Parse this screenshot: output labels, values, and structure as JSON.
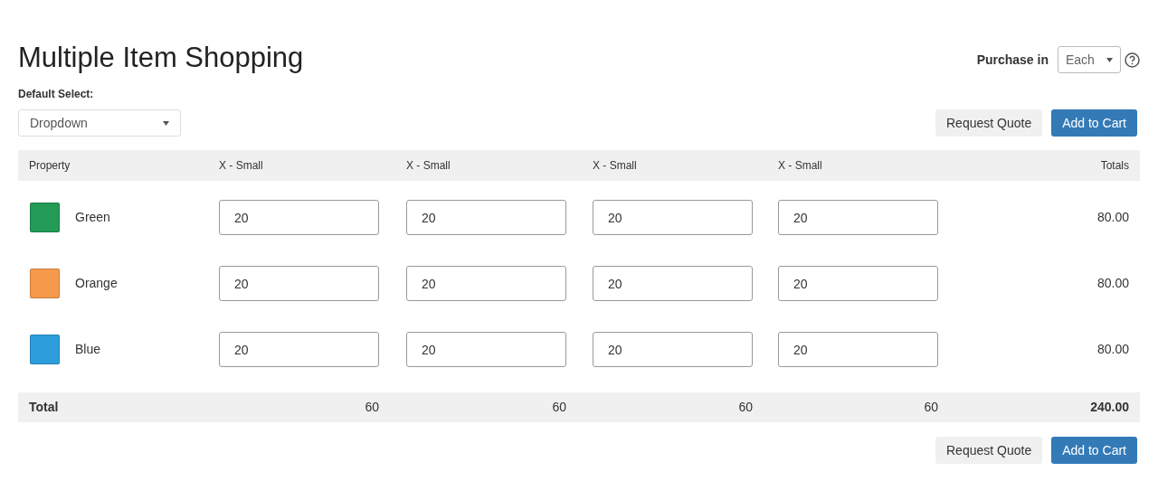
{
  "title": "Multiple Item Shopping",
  "purchase_in": {
    "label": "Purchase in",
    "value": "Each"
  },
  "default_select": {
    "label": "Default Select:",
    "value": "Dropdown"
  },
  "actions_top": [
    {
      "label": "Request Quote",
      "kind": "secondary"
    },
    {
      "label": "Add to Cart",
      "kind": "primary"
    }
  ],
  "table": {
    "columns": [
      "Property",
      "X - Small",
      "X - Small",
      "X - Small",
      "X - Small",
      "Totals"
    ],
    "rows": [
      {
        "name": "Green",
        "color": "#239a55",
        "quantities": [
          "20",
          "20",
          "20",
          "20"
        ],
        "total": "80.00"
      },
      {
        "name": "Orange",
        "color": "#f59a4a",
        "quantities": [
          "20",
          "20",
          "20",
          "20"
        ],
        "total": "80.00"
      },
      {
        "name": "Blue",
        "color": "#2d9ddc",
        "quantities": [
          "20",
          "20",
          "20",
          "20"
        ],
        "total": "80.00"
      }
    ],
    "footer": {
      "label": "Total",
      "sums": [
        "60",
        "60",
        "60",
        "60"
      ],
      "total": "240.00"
    }
  },
  "actions_bottom": [
    {
      "label": "Request Quote",
      "kind": "secondary"
    },
    {
      "label": "Add to Cart",
      "kind": "primary"
    }
  ]
}
